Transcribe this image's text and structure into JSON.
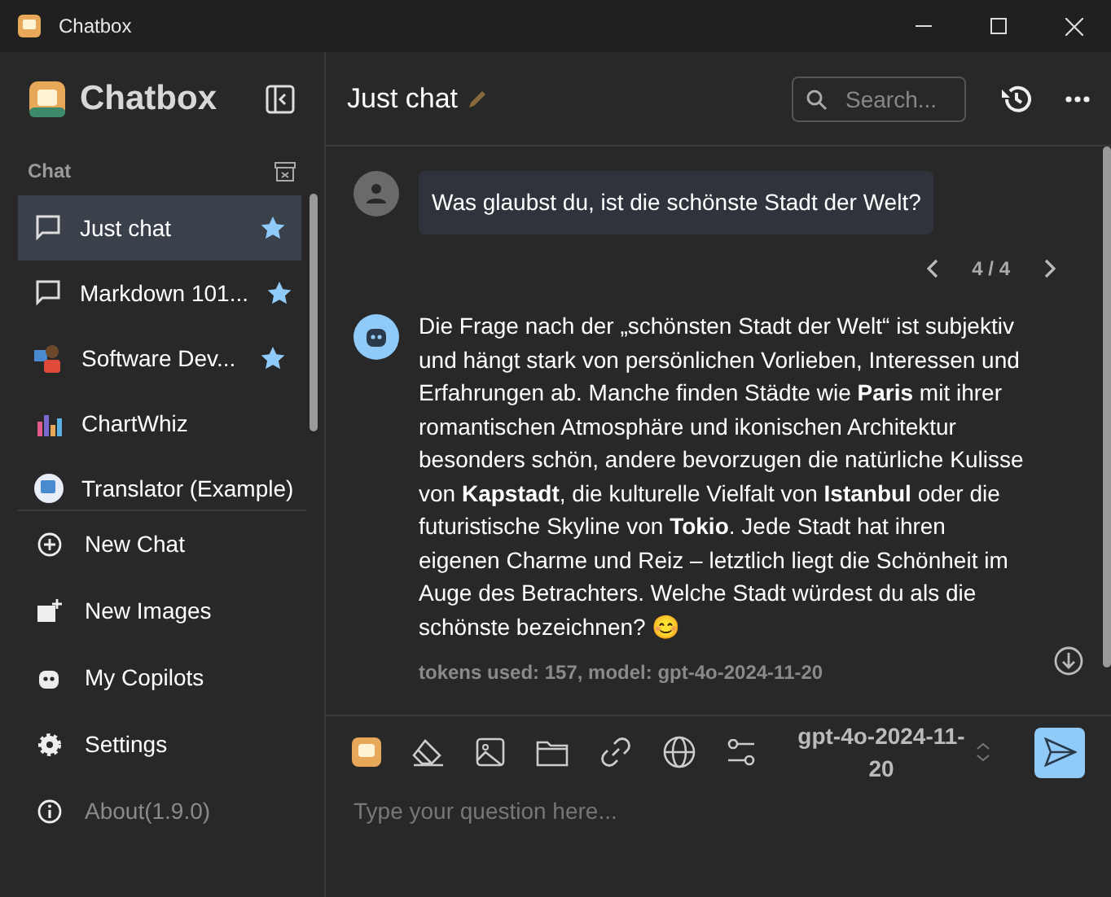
{
  "window": {
    "title": "Chatbox"
  },
  "sidebar": {
    "app_name": "Chatbox",
    "section_label": "Chat",
    "sessions": [
      {
        "label": "Just chat",
        "kind": "chat",
        "starred": true,
        "selected": true
      },
      {
        "label": "Markdown 101...",
        "kind": "chat",
        "starred": true,
        "selected": false
      },
      {
        "label": "Software Dev...",
        "kind": "avatar",
        "starred": true,
        "selected": false
      },
      {
        "label": "ChartWhiz",
        "kind": "chart",
        "starred": false,
        "selected": false
      },
      {
        "label": "Translator (Example)",
        "kind": "translator",
        "starred": false,
        "selected": false
      }
    ],
    "menu": [
      {
        "label": "New Chat",
        "kind": "plus",
        "dimmed": false
      },
      {
        "label": "New Images",
        "kind": "image",
        "dimmed": false
      },
      {
        "label": "My Copilots",
        "kind": "robot",
        "dimmed": false
      },
      {
        "label": "Settings",
        "kind": "gear",
        "dimmed": false
      },
      {
        "label": "About(1.9.0)",
        "kind": "info",
        "dimmed": true
      }
    ]
  },
  "header": {
    "title": "Just chat",
    "search": {
      "placeholder": "Search..."
    }
  },
  "messages": [
    {
      "kind": "user",
      "text": "Was glaubst du, ist die schönste Stadt der Welt?",
      "pager": "4 / 4"
    },
    {
      "kind": "assistant",
      "text": "Die Frage nach der „schönsten Stadt der Welt“ ist subjektiv und hängt stark von persönlichen Vorlieben, Interessen und Erfahrungen ab. Manche finden Städte wie **Paris** mit ihrer romantischen Atmosphäre und ikonischen Architektur besonders schön, andere bevorzugen die natürliche Kulisse von **Kapstadt**, die kulturelle Vielfalt von **Istanbul** oder die futuristische Skyline von **Tokio**. Jede Stadt hat ihren eigenen Charme und Reiz – letztlich liegt die Schönheit im Auge des Betrachters. Welche Stadt würdest du als die schönste bezeichnen? 😊",
      "meta": "tokens used: 157, model: gpt-4o-2024-11-20"
    }
  ],
  "composer": {
    "model": "gpt-4o-2024-11-20",
    "placeholder": "Type your question here..."
  }
}
